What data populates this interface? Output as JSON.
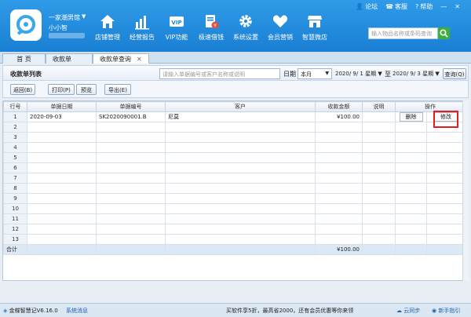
{
  "app": {
    "shop_name": "一家潮男馆",
    "user_name": "小小智"
  },
  "nav": [
    {
      "label": "店铺管理",
      "icon": "home-icon"
    },
    {
      "label": "经营报告",
      "icon": "bar-chart-icon"
    },
    {
      "label": "VIP功能",
      "icon": "vip-card-icon"
    },
    {
      "label": "极速借钱",
      "icon": "money-icon"
    },
    {
      "label": "系统设置",
      "icon": "gear-icon"
    },
    {
      "label": "会员营销",
      "icon": "heart-icon"
    },
    {
      "label": "智慧微店",
      "icon": "store-icon"
    }
  ],
  "toplinks": {
    "forum": "论坛",
    "service": "客服",
    "help": "帮助"
  },
  "search": {
    "placeholder": "输入物品名称或条码查询"
  },
  "tabs": [
    {
      "label": "首 页"
    },
    {
      "label": "收款单"
    },
    {
      "label": "收款单查询"
    }
  ],
  "page": {
    "title": "收款单列表",
    "query_placeholder": "请输入单据编号或客户名称或说明",
    "date_label": "日期",
    "period": "本月",
    "date_from": "2020/ 9/ 1 星期",
    "date_to_label": "至",
    "date_to": "2020/ 9/ 3 星期",
    "query_btn": "查询(Q)"
  },
  "toolbar": {
    "back": "返回(B)",
    "print": "打印(P)",
    "preview": "预览",
    "export": "导出(E)"
  },
  "table": {
    "headers": [
      "行号",
      "单据日期",
      "单据编号",
      "客户",
      "收款金额",
      "说明",
      "操作"
    ],
    "rows": [
      {
        "no": "1",
        "date": "2020-09-03",
        "code": "SK2020090001.B",
        "customer": "尼莫",
        "amount": "¥100.00",
        "note": "",
        "delete": "删除",
        "edit": "修改"
      },
      {
        "no": "2"
      },
      {
        "no": "3"
      },
      {
        "no": "4"
      },
      {
        "no": "5"
      },
      {
        "no": "6"
      },
      {
        "no": "7"
      },
      {
        "no": "8"
      },
      {
        "no": "9"
      },
      {
        "no": "10"
      },
      {
        "no": "11"
      },
      {
        "no": "12"
      },
      {
        "no": "13"
      }
    ],
    "total_label": "合计",
    "total_amount": "¥100.00"
  },
  "status": {
    "version": "金蝶智慧记V6.16.0",
    "messages": "系统消息",
    "promo": "买软件享5折，最高省2000，还有会员优惠等你来领",
    "cloud_sync": "云同步",
    "guide": "新手指引"
  }
}
